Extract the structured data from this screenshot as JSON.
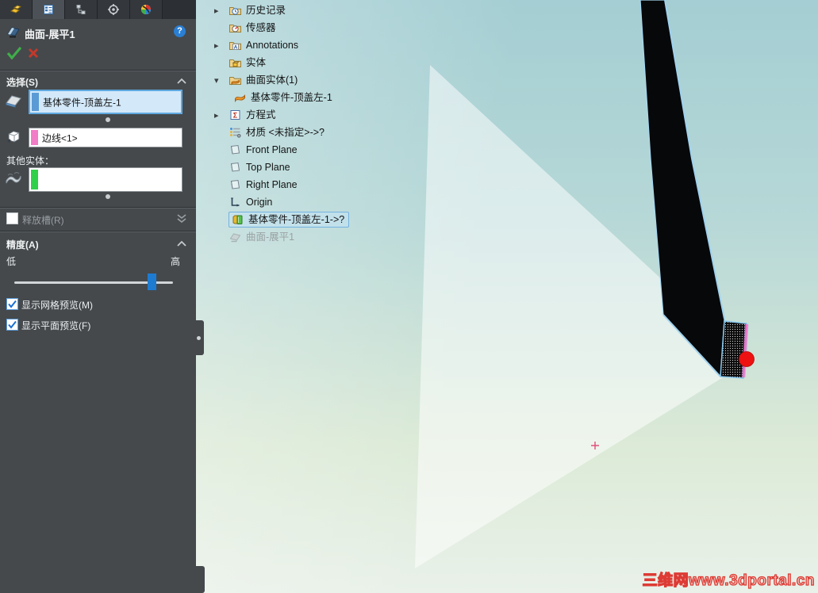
{
  "panel": {
    "tabs": [
      {
        "icon": "featuremanager-part-icon"
      },
      {
        "icon": "propertymanager-icon",
        "active": true
      },
      {
        "icon": "configurationmanager-icon"
      },
      {
        "icon": "dimxpertmanager-icon"
      },
      {
        "icon": "displaymanager-icon"
      }
    ],
    "title": "曲面-展平1",
    "help_label": "?",
    "selection_section": {
      "header": "选择(S)",
      "surface_field": {
        "value": "基体零件-顶盖左-1",
        "strip_color": "#5b9bd5"
      },
      "edge_field": {
        "value": "边线<1>",
        "strip_color": "#f27cc5"
      },
      "other_entities_label": "其他实体：",
      "other_field": {
        "value": "",
        "strip_color": "#2fd04a"
      }
    },
    "relief_section": {
      "label": "释放槽(R)",
      "checked": false
    },
    "accuracy_section": {
      "header": "精度(A)",
      "low_label": "低",
      "high_label": "高",
      "slider_percent": 87,
      "checkboxes": [
        {
          "label": "显示网格预览(M)",
          "checked": true
        },
        {
          "label": "显示平面预览(F)",
          "checked": true
        }
      ]
    }
  },
  "tree": {
    "items": [
      {
        "label": "历史记录",
        "state": "collapsed"
      },
      {
        "label": "传感器"
      },
      {
        "label": "Annotations",
        "state": "collapsed"
      },
      {
        "label": "实体"
      },
      {
        "label": "曲面实体(1)",
        "state": "expanded"
      },
      {
        "label": "基体零件-顶盖左-1",
        "child": true
      },
      {
        "label": "方程式",
        "state": "collapsed"
      },
      {
        "label": "材质 <未指定>->?"
      },
      {
        "label": "Front Plane"
      },
      {
        "label": "Top Plane"
      },
      {
        "label": "Right Plane"
      },
      {
        "label": "Origin"
      },
      {
        "label": "基体零件-顶盖左-1->?",
        "selected": true
      },
      {
        "label": "曲面-展平1",
        "greyed": true
      }
    ]
  },
  "viewport": {
    "watermark": "三维网www.3dportal.cn",
    "colors": {
      "selected_edge_pink": "#f070c8",
      "fixed_point_red": "#ee1111",
      "edge_highlight_blue": "#9fd2ef",
      "accent_blue": "#1d7cd2",
      "background_top": "#a4ced3",
      "background_bottom": "#e9f1e9"
    }
  }
}
